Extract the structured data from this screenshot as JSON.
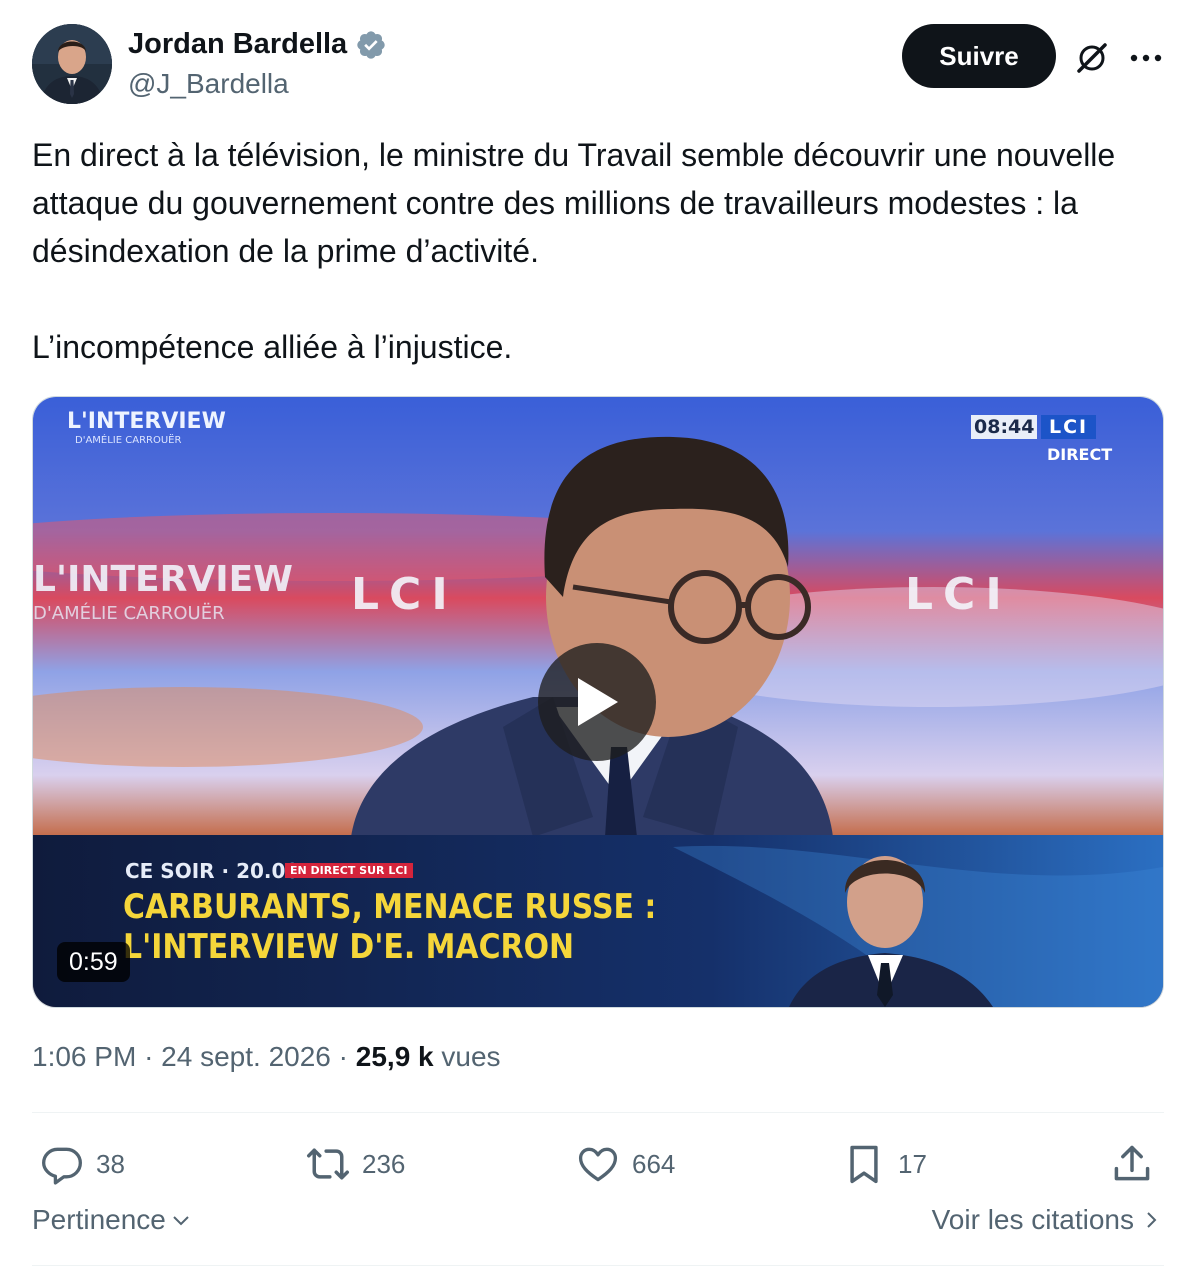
{
  "author": {
    "name": "Jordan Bardella",
    "handle": "@J_Bardella",
    "verified_icon": "verified-badge-icon"
  },
  "header": {
    "follow_label": "Suivre"
  },
  "tweet": {
    "paragraph_1": "En direct à la télévision, le ministre du Travail semble découvrir une nouvelle attaque du gouvernement contre des millions de travailleurs modestes : la désindexation de la prime d’activité.",
    "paragraph_2": "L’incompétence alliée à l’injustice."
  },
  "video": {
    "duration": "0:59",
    "overlay": {
      "top_left_title": "L'INTERVIEW",
      "top_left_subtitle": "D'AMÉLIE CARROUËR",
      "clock": "08:44",
      "channel": "LCI",
      "live": "DIRECT",
      "backdrop_title": "L'INTERVIEW",
      "backdrop_subtitle": "D'AMÉLIE CARROUËR",
      "backdrop_logo_1": "LCI",
      "backdrop_logo_2": "LCI",
      "lower_third_time": "CE SOIR · 20.00",
      "lower_third_badge": "EN DIRECT SUR LCI",
      "headline_1": "CARBURANTS, MENACE RUSSE :",
      "headline_2": "L'INTERVIEW D'E. MACRON"
    }
  },
  "meta": {
    "time": "1:06 PM",
    "separator": "·",
    "date": "24 sept. 2026",
    "views_count": "25,9 k",
    "views_label": "vues"
  },
  "actions": {
    "replies": "38",
    "retweets": "236",
    "likes": "664",
    "bookmarks": "17"
  },
  "footer": {
    "sort_label": "Pertinence",
    "quotes_label": "Voir les citations"
  },
  "colors": {
    "text": "#0f1419",
    "secondary": "#536471",
    "verified": "#829aab",
    "divider": "#eff3f4"
  }
}
